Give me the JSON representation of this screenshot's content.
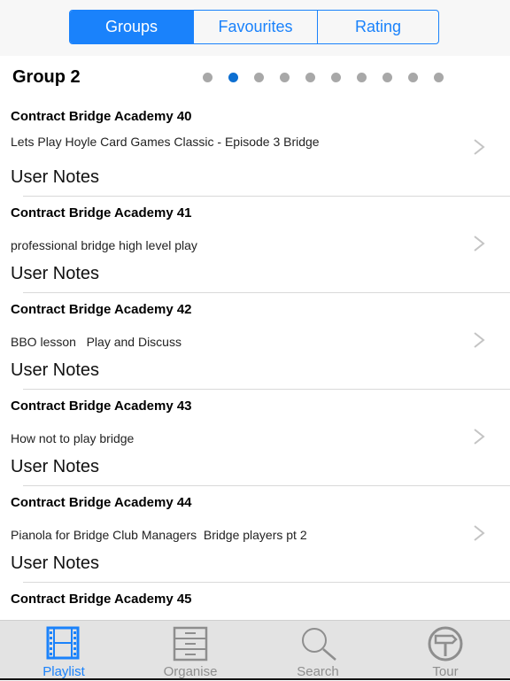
{
  "segments": {
    "items": [
      "Groups",
      "Favourites",
      "Rating"
    ],
    "selected": 0
  },
  "group": {
    "title": "Group 2",
    "page_count": 10,
    "current_page": 2
  },
  "list": [
    {
      "title": "Contract Bridge Academy 40",
      "subtitle": "Lets Play Hoyle Card Games Classic - Episode 3 Bridge",
      "notes": "User Notes"
    },
    {
      "title": "Contract Bridge Academy 41",
      "subtitle": "professional bridge high level play",
      "notes": "User Notes"
    },
    {
      "title": "Contract Bridge Academy 42",
      "subtitle": "BBO lesson   Play and Discuss",
      "notes": "User Notes"
    },
    {
      "title": "Contract Bridge Academy 43",
      "subtitle": "How not to play bridge",
      "notes": "User Notes"
    },
    {
      "title": "Contract Bridge Academy 44",
      "subtitle": "Pianola for Bridge Club Managers  Bridge players pt 2",
      "notes": "User Notes"
    },
    {
      "title": "Contract Bridge Academy 45",
      "subtitle": "",
      "notes": ""
    }
  ],
  "tabbar": {
    "items": [
      {
        "label": "Playlist",
        "icon": "film-strip-icon",
        "active": true
      },
      {
        "label": "Organise",
        "icon": "filing-cabinet-icon",
        "active": false
      },
      {
        "label": "Search",
        "icon": "magnifier-icon",
        "active": false
      },
      {
        "label": "Tour",
        "icon": "signpost-icon",
        "active": false
      }
    ]
  },
  "colors": {
    "accent": "#1a82fb",
    "active_dot": "#0d6fd1",
    "inactive_dot": "#a8a8a8",
    "inactive_tab": "#8e8e8e"
  }
}
